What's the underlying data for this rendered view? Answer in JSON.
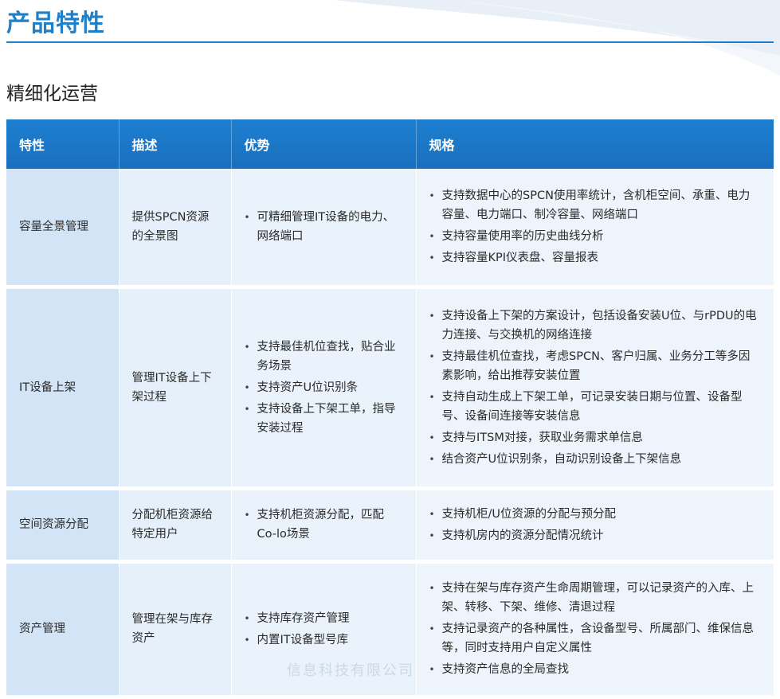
{
  "page_title": "产品特性",
  "section_title": "精细化运营",
  "table": {
    "headers": [
      "特性",
      "描述",
      "优势",
      "规格"
    ],
    "rows": [
      {
        "feature": "容量全景管理",
        "description": "提供SPCN资源的全景图",
        "advantages": [
          "可精细管理IT设备的电力、网络端口"
        ],
        "specs": [
          "支持数据中心的SPCN使用率统计，含机柜空间、承重、电力容量、电力端口、制冷容量、网络端口",
          "支持容量使用率的历史曲线分析",
          "支持容量KPI仪表盘、容量报表"
        ]
      },
      {
        "feature": "IT设备上架",
        "description": "管理IT设备上下架过程",
        "advantages": [
          "支持最佳机位查找，贴合业务场景",
          "支持资产U位识别条",
          "支持设备上下架工单，指导安装过程"
        ],
        "specs": [
          "支持设备上下架的方案设计，包括设备安装U位、与rPDU的电力连接、与交换机的网络连接",
          "支持最佳机位查找，考虑SPCN、客户归属、业务分工等多因素影响，给出推荐安装位置",
          "支持自动生成上下架工单，可记录安装日期与位置、设备型号、设备间连接等安装信息",
          "支持与ITSM对接，获取业务需求单信息",
          "结合资产U位识别条，自动识别设备上下架信息"
        ]
      },
      {
        "feature": "空间资源分配",
        "description": "分配机柜资源给特定用户",
        "advantages": [
          "支持机柜资源分配，匹配Co-lo场景"
        ],
        "specs": [
          "支持机柜/U位资源的分配与预分配",
          "支持机房内的资源分配情况统计"
        ]
      },
      {
        "feature": "资产管理",
        "description": "管理在架与库存资产",
        "advantages": [
          "支持库存资产管理",
          "内置IT设备型号库"
        ],
        "specs": [
          "支持在架与库存资产生命周期管理，可以记录资产的入库、上架、转移、下架、维修、清退过程",
          "支持记录资产的各种属性，含设备型号、所属部门、维保信息等，同时支持用户自定义属性",
          "支持资产信息的全局查找"
        ]
      }
    ]
  },
  "watermark": "信息科技有限公司"
}
